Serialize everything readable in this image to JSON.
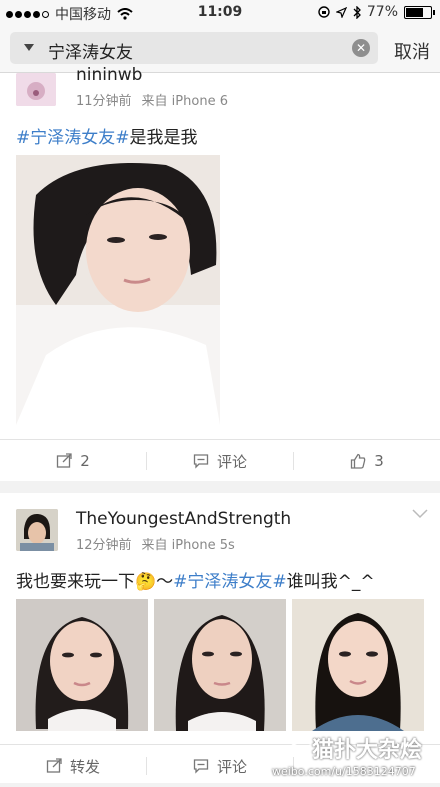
{
  "status": {
    "carrier": "中国移动",
    "time": "11:09",
    "battery": "77%",
    "battery_level": 0.77
  },
  "search": {
    "query": "宁泽涛女友",
    "cancel": "取消"
  },
  "post1": {
    "username": "nininwb",
    "time": "11分钟前",
    "source": "来自 iPhone 6",
    "tag": "#宁泽涛女友#",
    "text": "是我是我",
    "repost_count": "2",
    "comment_label": "评论",
    "like_count": "3"
  },
  "post2": {
    "username": "TheYoungestAndStrength",
    "time": "12分钟前",
    "source": "来自 iPhone 5s",
    "text_before": "我也要来玩一下🤔～",
    "tag": "#宁泽涛女友#",
    "text_after": "谁叫我^_^",
    "repost_label": "转发",
    "comment_label": "评论"
  },
  "watermark": {
    "name": "猫扑大杂烩",
    "url": "weibo.com/u/1583124707"
  },
  "colors": {
    "tag": "#3d7ec9",
    "meta": "#888888",
    "background": "#f2f2f2"
  }
}
